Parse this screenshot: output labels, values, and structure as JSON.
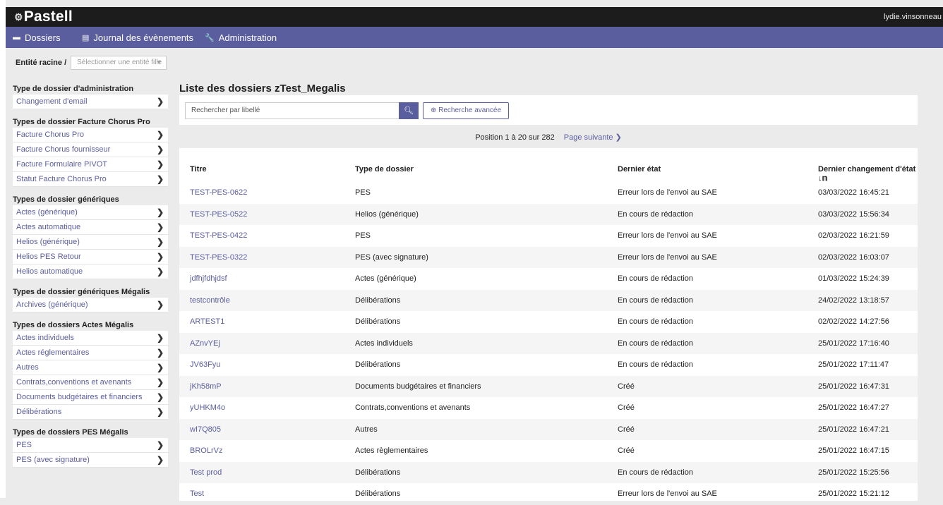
{
  "app": {
    "logo_text": "Pastell",
    "user": "lydie.vinsonneau"
  },
  "nav": [
    {
      "label": "Dossiers",
      "icon": "folder-icon"
    },
    {
      "label": "Journal des évènements",
      "icon": "list-icon"
    },
    {
      "label": "Administration",
      "icon": "wrench-icon"
    }
  ],
  "entity": {
    "label": "Entité racine /",
    "placeholder": "Sélectionner une entité fille"
  },
  "sidebar": [
    {
      "title": "Type de dossier d'administration",
      "items": [
        "Changement d'email"
      ]
    },
    {
      "title": "Types de dossier Facture Chorus Pro",
      "items": [
        "Facture Chorus Pro",
        "Facture Chorus fournisseur",
        "Facture Formulaire PIVOT",
        "Statut Facture Chorus Pro"
      ]
    },
    {
      "title": "Types de dossier génériques",
      "items": [
        "Actes (générique)",
        "Actes automatique",
        "Helios (générique)",
        "Helios PES Retour",
        "Helios automatique"
      ]
    },
    {
      "title": "Types de dossier génériques Mégalis",
      "items": [
        "Archives (générique)"
      ]
    },
    {
      "title": "Types de dossiers Actes Mégalis",
      "items": [
        "Actes individuels",
        "Actes réglementaires",
        "Autres",
        "Contrats,conventions et avenants",
        "Documents budgétaires et financiers",
        "Délibérations"
      ]
    },
    {
      "title": "Types de dossiers PES Mégalis",
      "items": [
        "PES",
        "PES (avec signature)"
      ]
    }
  ],
  "main": {
    "title": "Liste des dossiers zTest_Megalis",
    "search_placeholder": "Rechercher par libellé",
    "advanced_search": "Recherche avancée",
    "pager_text": "Position 1 à 20 sur 282",
    "next_page": "Page suivante"
  },
  "table": {
    "headers": [
      "Titre",
      "Type de dossier",
      "Dernier état",
      "Dernier changement d'état"
    ],
    "rows": [
      [
        "TEST-PES-0622",
        "PES",
        "Erreur lors de l'envoi au SAE",
        "03/03/2022 16:45:21"
      ],
      [
        "TEST-PES-0522",
        "Helios (générique)",
        "En cours de rédaction",
        "03/03/2022 15:56:34"
      ],
      [
        "TEST-PES-0422",
        "PES",
        "Erreur lors de l'envoi au SAE",
        "02/03/2022 16:21:59"
      ],
      [
        "TEST-PES-0322",
        "PES (avec signature)",
        "Erreur lors de l'envoi au SAE",
        "02/03/2022 16:03:07"
      ],
      [
        "jdfhjfdhjdsf",
        "Actes (générique)",
        "En cours de rédaction",
        "01/03/2022 15:24:39"
      ],
      [
        "testcontrôle",
        "Délibérations",
        "En cours de rédaction",
        "24/02/2022 13:18:57"
      ],
      [
        "ARTEST1",
        "Délibérations",
        "En cours de rédaction",
        "02/02/2022 14:27:56"
      ],
      [
        "AZnvYEj",
        "Actes individuels",
        "En cours de rédaction",
        "25/01/2022 17:16:40"
      ],
      [
        "JV63Fyu",
        "Délibérations",
        "En cours de rédaction",
        "25/01/2022 17:11:47"
      ],
      [
        "jKh58mP",
        "Documents budgétaires et financiers",
        "Créé",
        "25/01/2022 16:47:31"
      ],
      [
        "yUHKM4o",
        "Contrats,conventions et avenants",
        "Créé",
        "25/01/2022 16:47:27"
      ],
      [
        "wI7Q805",
        "Autres",
        "Créé",
        "25/01/2022 16:47:21"
      ],
      [
        "BROLrVz",
        "Actes règlementaires",
        "Créé",
        "25/01/2022 16:47:15"
      ],
      [
        "Test prod",
        "Délibérations",
        "En cours de rédaction",
        "25/01/2022 15:25:56"
      ],
      [
        "Test",
        "Délibérations",
        "Erreur lors de l'envoi au SAE",
        "25/01/2022 15:21:12"
      ]
    ]
  },
  "colors": {
    "accent": "#5b5e9e",
    "topbar": "#1c1c1c"
  }
}
